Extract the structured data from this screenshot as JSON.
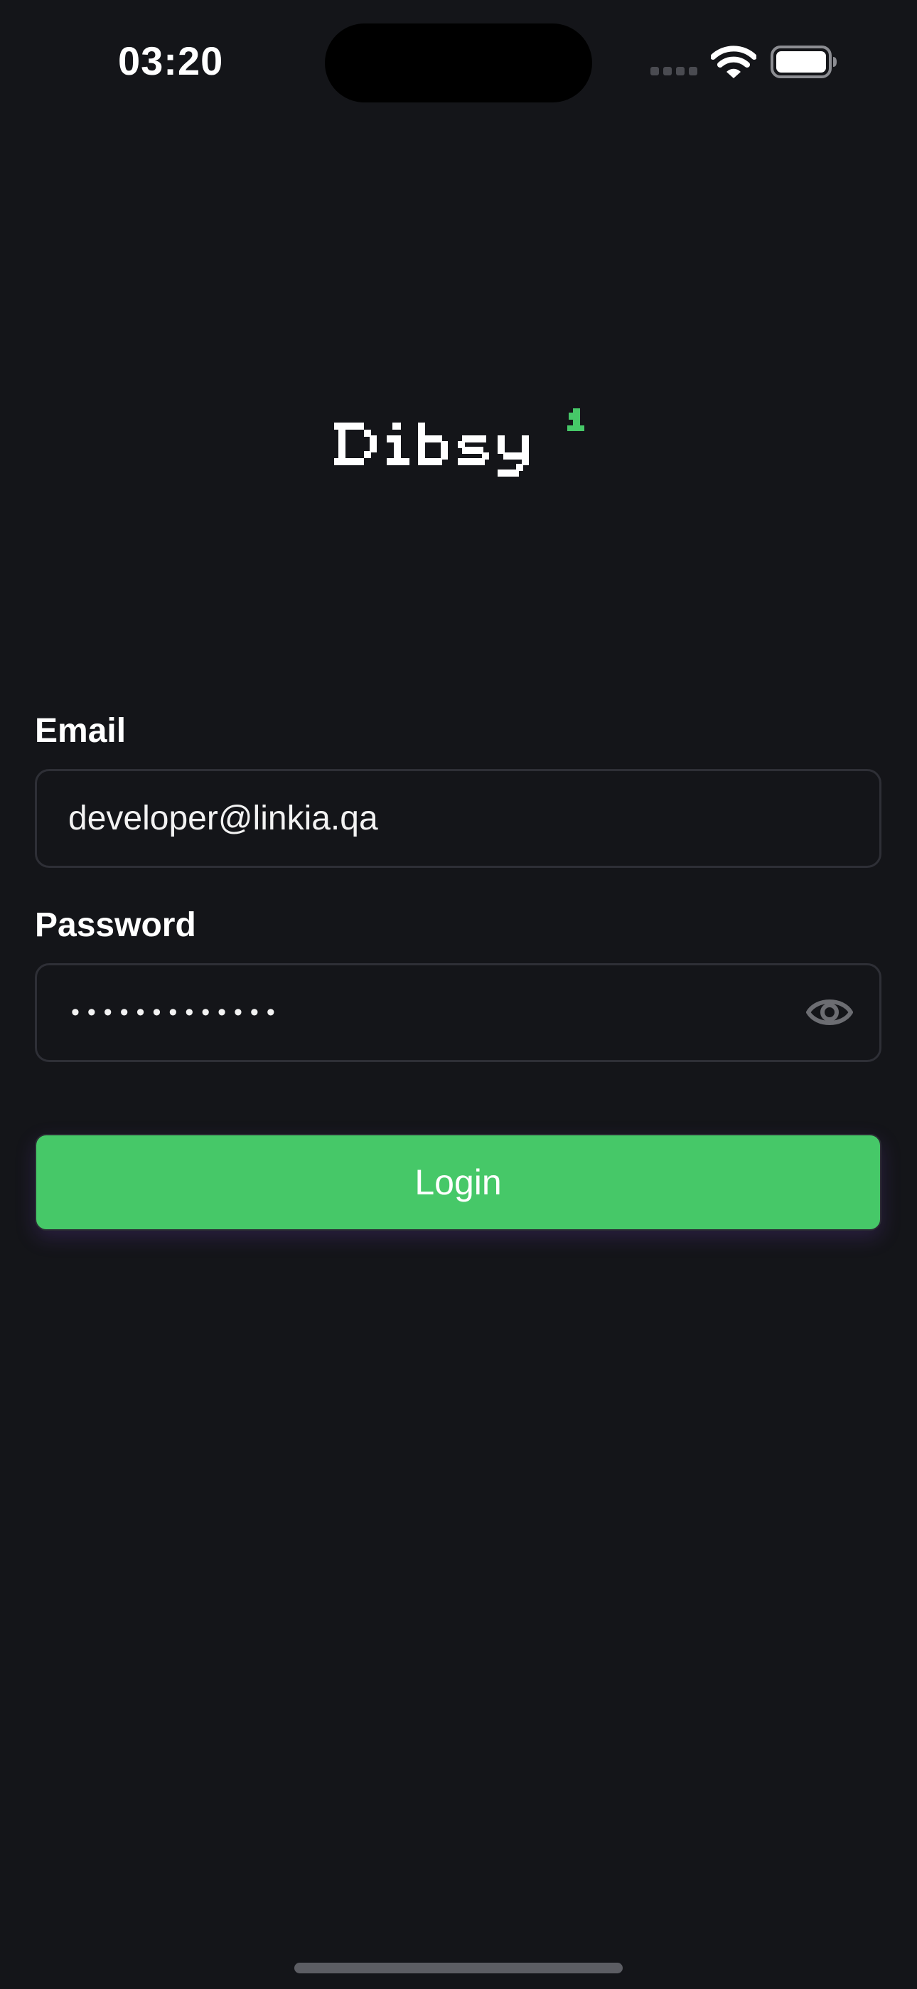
{
  "status_bar": {
    "time": "03:20"
  },
  "logo": {
    "text": "Dibsy",
    "badge": "1",
    "accent_color": "#46c868"
  },
  "form": {
    "email": {
      "label": "Email",
      "value": "developer@linkia.qa"
    },
    "password": {
      "label": "Password",
      "masked_value": "•••••••••••••",
      "toggle_icon": "eye-icon"
    },
    "login_label": "Login"
  },
  "colors": {
    "background": "#141519",
    "primary_button": "#46c868",
    "field_border": "#2e2f36"
  }
}
